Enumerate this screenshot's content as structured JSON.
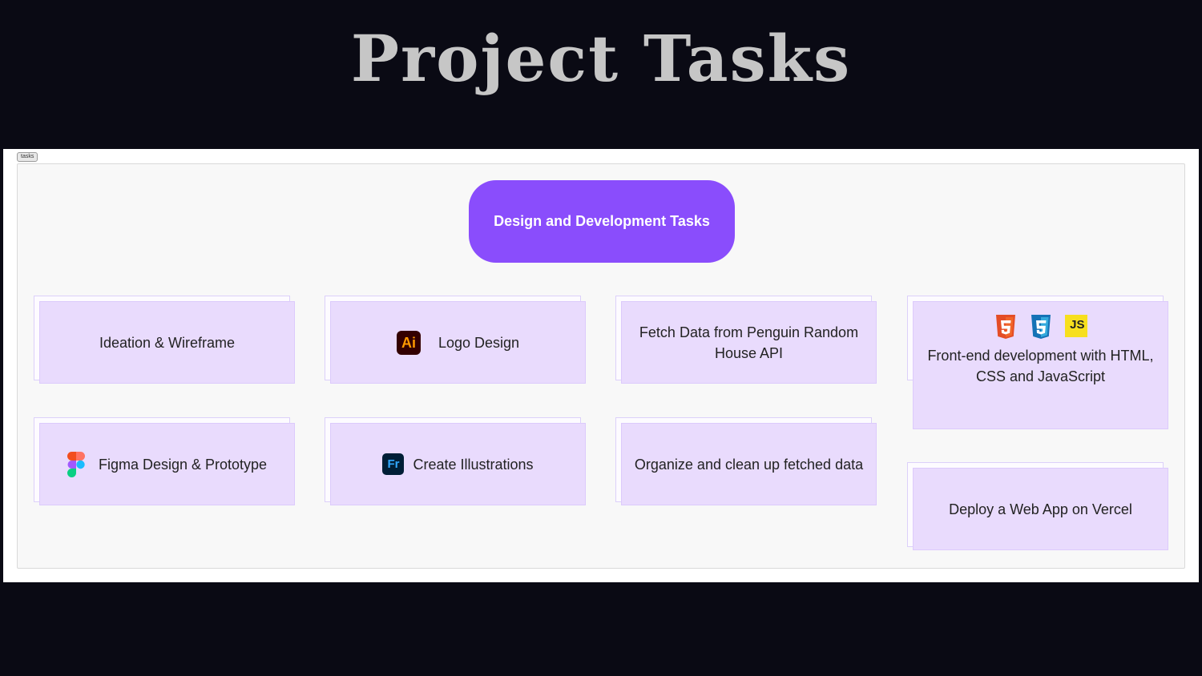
{
  "page": {
    "title": "Project Tasks"
  },
  "board": {
    "frame_tag": "tasks"
  },
  "root": {
    "label": "Design and Development Tasks"
  },
  "tasks": {
    "ideation": "Ideation & Wireframe",
    "figma": "Figma Design & Prototype",
    "logo": "Logo Design",
    "illustrations": "Create Illustrations",
    "fetch": "Fetch Data from Penguin Random House API",
    "organize": "Organize and clean up fetched data",
    "frontend": "Front-end development with HTML, CSS and JavaScript",
    "deploy": "Deploy a Web App on Vercel"
  },
  "icons": {
    "illustrator": {
      "name": "adobe-illustrator-icon",
      "text": "Ai",
      "bg": "#330000",
      "fg": "#ff9a00"
    },
    "fresco": {
      "name": "adobe-fresco-icon",
      "text": "Fr",
      "bg": "#001e36",
      "fg": "#31a8ff"
    },
    "figma": {
      "name": "figma-icon"
    },
    "html5": {
      "name": "html5-icon",
      "color": "#e44d26"
    },
    "css3": {
      "name": "css3-icon",
      "color": "#2965f1"
    },
    "javascript": {
      "name": "javascript-icon",
      "text": "JS",
      "color": "#f7df1e"
    }
  },
  "colors": {
    "background": "#0a0a14",
    "root_node": "#8a4dfc",
    "card": "#e9dbfd"
  }
}
